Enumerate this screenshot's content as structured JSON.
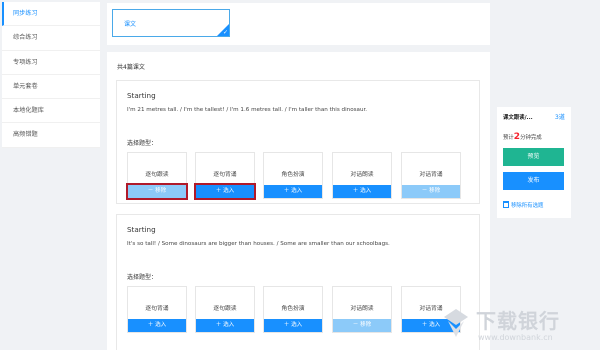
{
  "sidebar": {
    "items": [
      {
        "label": "同步练习",
        "active": true
      },
      {
        "label": "综合练习",
        "active": false
      },
      {
        "label": "专项练习",
        "active": false
      },
      {
        "label": "单元套卷",
        "active": false
      },
      {
        "label": "本地化题库",
        "active": false
      },
      {
        "label": "高频错题",
        "active": false
      }
    ]
  },
  "top": {
    "lesson_label": "课文",
    "check": "✓"
  },
  "main": {
    "count_label": "共4篇课文",
    "cards": [
      {
        "title": "Starting",
        "sentence": "I'm 21 metres tall. / I'm the tallest! / I'm 1.6 metres tall. / I'm taller than this dinosaur.",
        "select_label": "选择题型：",
        "types": [
          {
            "name": "逐句跟读",
            "button": "－ 移除",
            "state": "remove",
            "outlined": true
          },
          {
            "name": "逐句背诵",
            "button": "＋ 选入",
            "state": "add",
            "outlined": true
          },
          {
            "name": "角色扮演",
            "button": "＋ 选入",
            "state": "add",
            "outlined": false
          },
          {
            "name": "对话朗读",
            "button": "＋ 选入",
            "state": "add",
            "outlined": false
          },
          {
            "name": "对话背诵",
            "button": "－ 移除",
            "state": "remove",
            "outlined": false
          }
        ]
      },
      {
        "title": "Starting",
        "sentence": "It's so tall! / Some dinosaurs are bigger than houses. / Some are smaller than our schoolbags.",
        "select_label": "选择题型：",
        "types": [
          {
            "name": "逐句背诵",
            "button": "＋ 选入",
            "state": "add",
            "outlined": false
          },
          {
            "name": "逐句跟读",
            "button": "＋ 选入",
            "state": "add",
            "outlined": false
          },
          {
            "name": "角色扮演",
            "button": "＋ 选入",
            "state": "add",
            "outlined": false
          },
          {
            "name": "对话朗读",
            "button": "－ 移除",
            "state": "remove",
            "outlined": false
          },
          {
            "name": "对话背诵",
            "button": "＋ 选入",
            "state": "add",
            "outlined": false
          }
        ]
      }
    ]
  },
  "summary": {
    "heading": "课文跟读/...",
    "count": "3道",
    "time_prefix": "预计",
    "time_value": "2",
    "time_suffix": "分钟完成",
    "preview_label": "预览",
    "publish_label": "发布",
    "clear_label": "移除所有选题"
  },
  "watermark": {
    "title": "下载银行",
    "url": "www.downbank.cn"
  },
  "colors": {
    "primary": "#1890ff",
    "preview": "#1fb592",
    "remove": "#8ccaf9",
    "highlight_outline": "#b01a2a",
    "time_accent": "#f5222d"
  }
}
